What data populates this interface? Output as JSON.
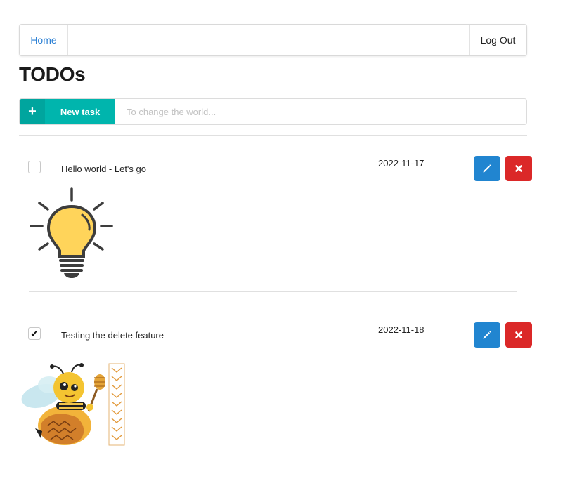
{
  "nav": {
    "home_label": "Home",
    "logout_label": "Log Out"
  },
  "page": {
    "title": "TODOs"
  },
  "new_task": {
    "button_label": "New task",
    "plus_symbol": "+",
    "input_placeholder": "To change the world...",
    "input_value": ""
  },
  "tasks": [
    {
      "text": "Hello world - Let's go",
      "date": "2022-11-17",
      "checked": false,
      "image_icon": "lightbulb-icon"
    },
    {
      "text": "Testing the delete feature",
      "date": "2022-11-18",
      "checked": true,
      "image_icon": "bee-honey-icon"
    }
  ],
  "icons": {
    "edit": "pencil-icon",
    "delete": "close-icon",
    "check": "✔"
  },
  "colors": {
    "accent": "#00b5ad",
    "edit": "#2185d0",
    "delete": "#db2828",
    "link": "#2a7fd4"
  }
}
